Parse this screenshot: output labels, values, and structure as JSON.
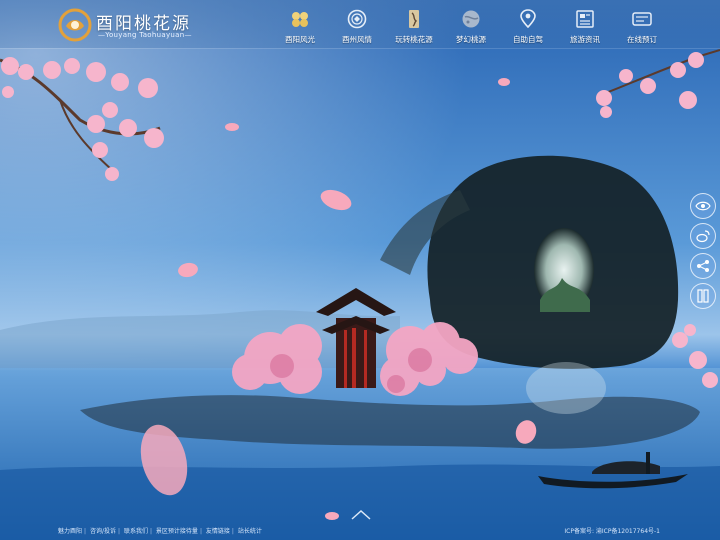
{
  "brand": {
    "name_cn": "酉阳桃花源",
    "name_en": "—Youyang Taohuayuan—",
    "accent": "#e3a13a"
  },
  "nav": {
    "items": [
      {
        "label": "酉阳风光",
        "icon": "coins-icon"
      },
      {
        "label": "酉州风情",
        "icon": "medallion-icon"
      },
      {
        "label": "玩转桃花源",
        "icon": "scroll-figure-icon"
      },
      {
        "label": "梦幻桃源",
        "icon": "moon-globe-icon"
      },
      {
        "label": "自助自驾",
        "icon": "map-pin-icon"
      },
      {
        "label": "旅游资讯",
        "icon": "news-icon"
      },
      {
        "label": "在线预订",
        "icon": "booking-icon"
      }
    ]
  },
  "side_tools": [
    "eye-icon",
    "weibo-icon",
    "share-icon",
    "book-icon"
  ],
  "footer": {
    "links": [
      "魅力酉阳",
      "咨询/投诉",
      "联系我们",
      "景区预计接待量",
      "友情链接",
      "站长统计"
    ],
    "icp": "ICP备案号: 渝ICP备12017764号-1"
  },
  "colors": {
    "sky": "#2d73bf",
    "blossom": "#f2a2c0",
    "header_text": "#ffffff"
  }
}
